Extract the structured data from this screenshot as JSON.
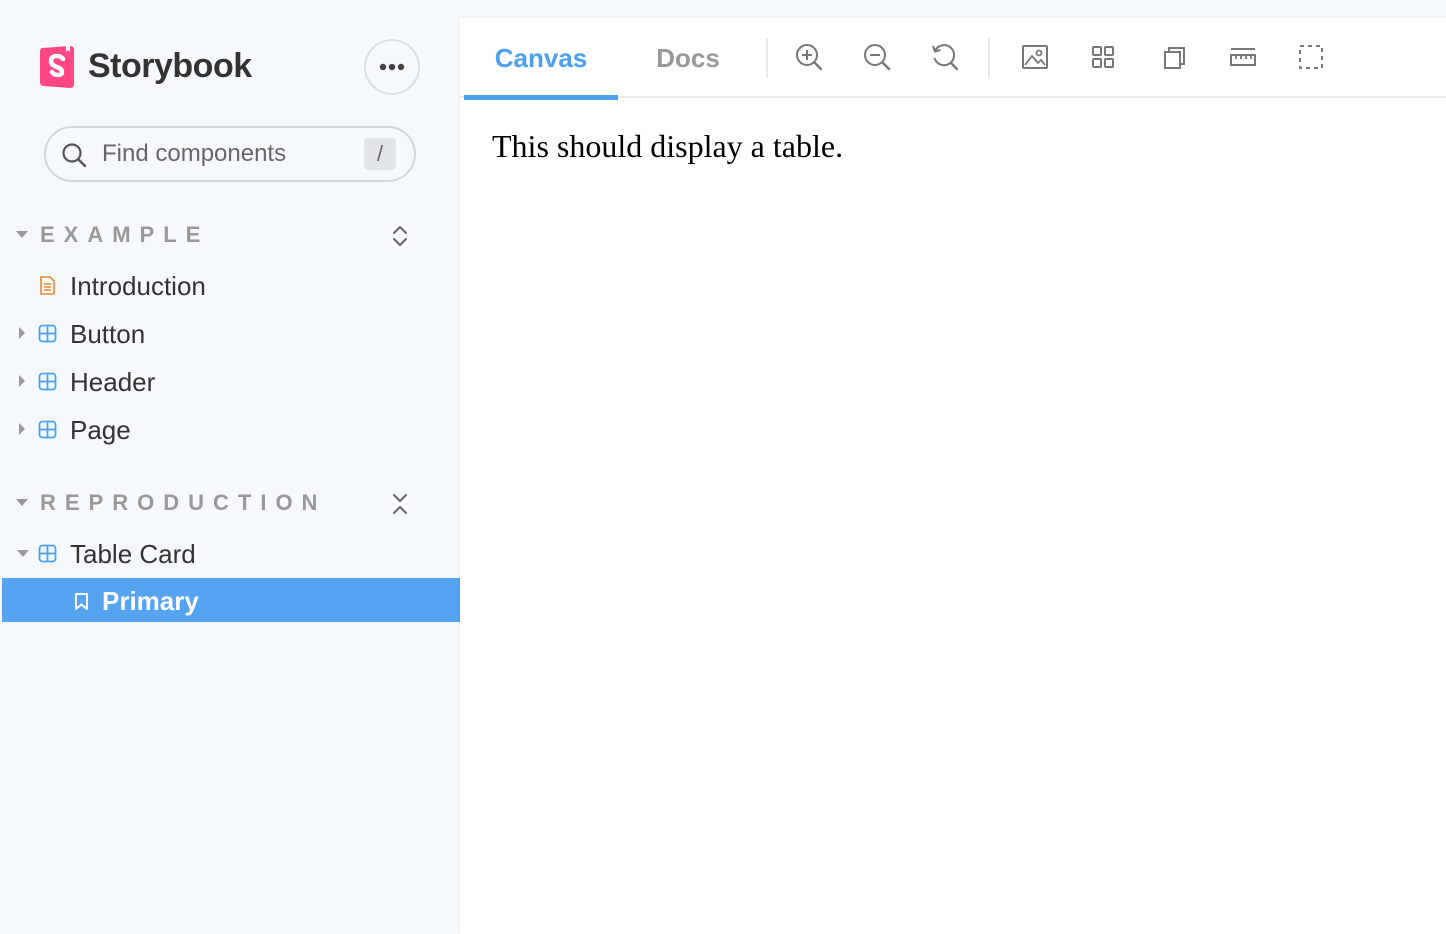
{
  "app": {
    "name": "Storybook",
    "brand_color": "#ff4785",
    "accent_color": "#4ca0f0",
    "menu_icon": "ellipsis-icon"
  },
  "search": {
    "placeholder": "Find components",
    "value": "",
    "shortcut": "/"
  },
  "sidebar": {
    "sections": [
      {
        "title": "EXAMPLE",
        "toggle_icon": "expand-all-icon",
        "items": [
          {
            "label": "Introduction",
            "icon": "document-icon"
          },
          {
            "label": "Button",
            "icon": "component-icon"
          },
          {
            "label": "Header",
            "icon": "component-icon"
          },
          {
            "label": "Page",
            "icon": "component-icon"
          }
        ]
      },
      {
        "title": "REPRODUCTION",
        "toggle_icon": "collapse-all-icon",
        "items": [
          {
            "label": "Table Card",
            "icon": "component-icon",
            "expanded": true
          },
          {
            "label": "Primary",
            "icon": "bookmark-icon",
            "selected": true
          }
        ]
      }
    ]
  },
  "toolbar": {
    "tabs": [
      {
        "label": "Canvas",
        "active": true
      },
      {
        "label": "Docs",
        "active": false
      }
    ],
    "tools": [
      "zoom-in-icon",
      "zoom-out-icon",
      "zoom-reset-icon",
      "background-icon",
      "grid-icon",
      "viewport-icon",
      "measure-icon",
      "outline-icon"
    ]
  },
  "canvas": {
    "text": "This should display a table."
  }
}
